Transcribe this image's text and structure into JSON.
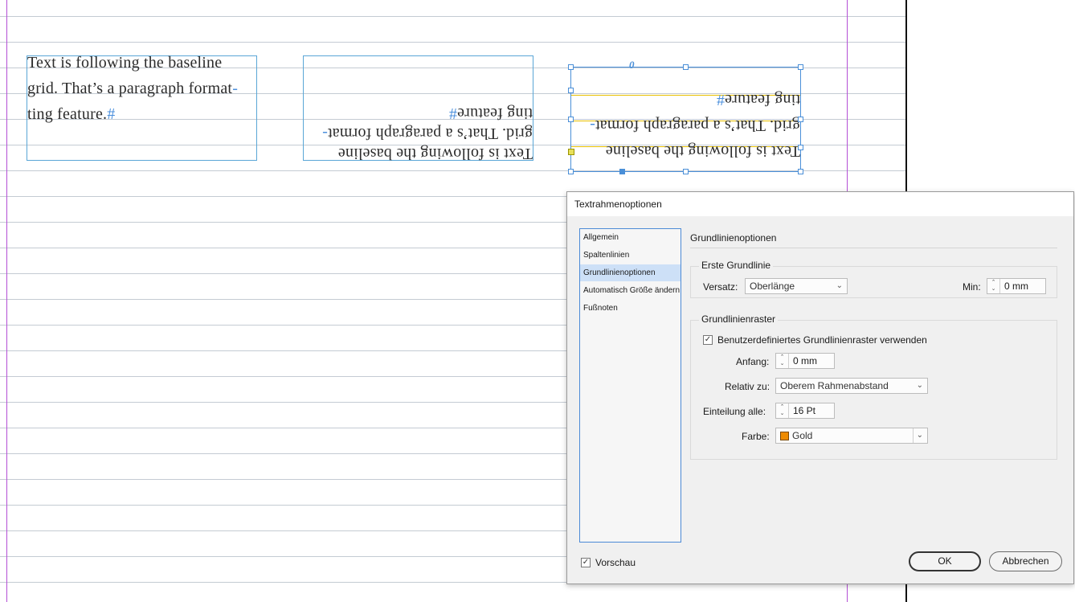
{
  "canvas": {
    "frame_normal": {
      "lines": [
        "Text is following the baseline",
        "grid. That’s a paragraph format",
        "ting feature."
      ],
      "hyphen": "-",
      "pilcrow": "#"
    },
    "frame_rotated": {
      "lines": [
        "Text is following the baseline",
        "grid. That’s a paragraph format",
        "ting feature"
      ],
      "hyphen": "-",
      "pilcrow": "#"
    },
    "frame_selected": {
      "lines": [
        "Text is following the baseline",
        "grid. That’s a paragraph format",
        "ting feature"
      ],
      "hyphen": "-",
      "pilcrow": "#",
      "rotation_marker": "0"
    },
    "colors": {
      "baseline_grid": "#c4cbd3",
      "margin_guide": "#b44fd6",
      "frame_edge": "#5aa6d6",
      "baseline_gold": "#e8c000"
    }
  },
  "dialog": {
    "title": "Textrahmenoptionen",
    "nav": [
      {
        "label": "Allgemein",
        "selected": false
      },
      {
        "label": "Spaltenlinien",
        "selected": false
      },
      {
        "label": "Grundlinienoptionen",
        "selected": true
      },
      {
        "label": "Automatisch Größe ändern",
        "selected": false
      },
      {
        "label": "Fußnoten",
        "selected": false
      }
    ],
    "section_title": "Grundlinienoptionen",
    "first_baseline": {
      "group_label": "Erste Grundlinie",
      "offset_label": "Versatz:",
      "offset_value": "Oberlänge",
      "min_label": "Min:",
      "min_value": "0 mm"
    },
    "baseline_grid": {
      "group_label": "Grundlinienraster",
      "custom_label": "Benutzerdefiniertes Grundlinienraster verwenden",
      "custom_checked": true,
      "start_label": "Anfang:",
      "start_value": "0 mm",
      "relative_label": "Relativ zu:",
      "relative_value": "Oberem Rahmenabstand",
      "increment_label": "Einteilung alle:",
      "increment_value": "16 Pt",
      "color_label": "Farbe:",
      "color_value": "Gold",
      "color_swatch": "#ee8b00"
    },
    "preview_label": "Vorschau",
    "preview_checked": true,
    "ok_label": "OK",
    "cancel_label": "Abbrechen"
  }
}
